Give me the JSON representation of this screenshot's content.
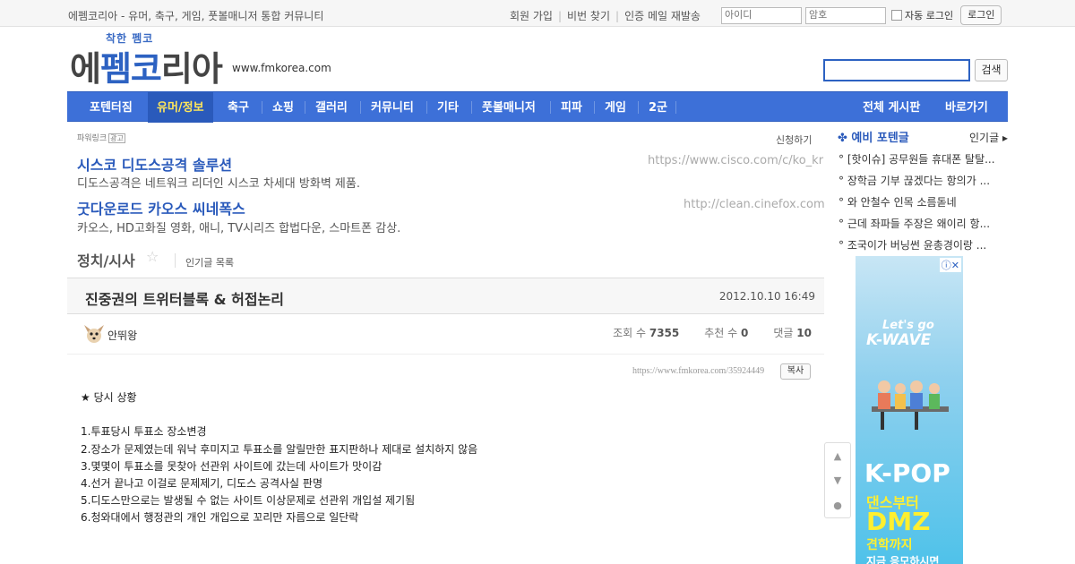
{
  "topbar": {
    "site_desc": "에펨코리아 - 유머, 축구, 게임, 풋볼매니저 통합 커뮤니티",
    "links": [
      "회원 가입",
      "비번 찾기",
      "인증 메일 재발송"
    ],
    "id_placeholder": "아이디",
    "pw_placeholder": "암호",
    "auto_login": "자동 로그인",
    "login_btn": "로그인"
  },
  "logo": {
    "small": "착한 펨코",
    "big_1": "에",
    "big_2": "펨코",
    "big_3": "리아",
    "url": "www.fmkorea.com"
  },
  "search": {
    "button": "검색"
  },
  "nav": {
    "items": [
      "포텐터짐",
      "유머/정보",
      "축구",
      "쇼핑",
      "갤러리",
      "커뮤니티",
      "기타",
      "풋볼매니저",
      "피파",
      "게임",
      "2군"
    ],
    "right": [
      "전체 게시판",
      "바로가기"
    ],
    "active_index": 1
  },
  "ads": {
    "label": "파워링크",
    "label_badge": "광고",
    "apply": "신청하기",
    "items": [
      {
        "title": "시스코 디도스공격 솔루션",
        "url": "https://www.cisco.com/c/ko_kr",
        "desc": "디도스공격은 네트워크 리더인 시스코 차세대 방화벽 제품."
      },
      {
        "title": "굿다운로드 카오스 씨네폭스",
        "url": "http://clean.cinefox.com",
        "desc": "카오스, HD고화질 영화, 애니, TV시리즈 합법다운, 스마트폰 감상."
      }
    ]
  },
  "board": {
    "title": "정치/시사",
    "star": "☆",
    "popular_list": "인기글 목록"
  },
  "post": {
    "title": "진중권의 트위터블록 & 허접논리",
    "date": "2012.10.10 16:49",
    "author": "안뛰왕",
    "views_label": "조회 수",
    "views": "7355",
    "recommend_label": "추천 수",
    "recommend": "0",
    "comments_label": "댓글",
    "comments": "10",
    "url": "https://www.fmkorea.com/35924449",
    "copy_btn": "복사",
    "lines": [
      "★ 당시 상황",
      "",
      "1.투표당시  투표소 장소변경",
      "2.장소가 문제였는데 워낙 후미지고 투표소를 알릴만한 표지판하나 제대로 설치하지 않음",
      "3.몇몇이 투표소를 못찾아 선관위 사이트에 갔는데 사이트가 맛이감",
      "4.선거 끝나고 이걸로 문제제기,  디도스 공격사실 판명",
      "5.디도스만으로는 발생될 수 없는 사이트 이상문제로 선관위 개입설 제기됨",
      "6.청와대에서 행정관의 개인 개입으로 꼬리만 자름으로 일단락"
    ]
  },
  "tools": [
    "▲",
    "▼",
    "●"
  ],
  "sidebar": {
    "title": "예비 포텐글",
    "more": "인기글",
    "items": [
      "[핫이슈] 공무원들 휴대폰 탈탈...",
      "장학금 기부 끊겠다는 항의가 ...",
      "와 안철수 인목 소름돋네",
      "근데 좌파들 주장은 왜이리 항...",
      "조국이가 버닝썬 윤총경이랑 ..."
    ]
  },
  "banner": {
    "close": "ⓘ✕",
    "kwave1": "Let's go",
    "kwave2": "K-WAVE",
    "kpop": "K-POP",
    "line1": "댄스부터",
    "dmz": "DMZ",
    "line2": "견학까지",
    "line3": "지금 응모하시면"
  },
  "colors": {
    "brand_blue": "#3d70d8",
    "nav_active": "#ffe65a"
  }
}
